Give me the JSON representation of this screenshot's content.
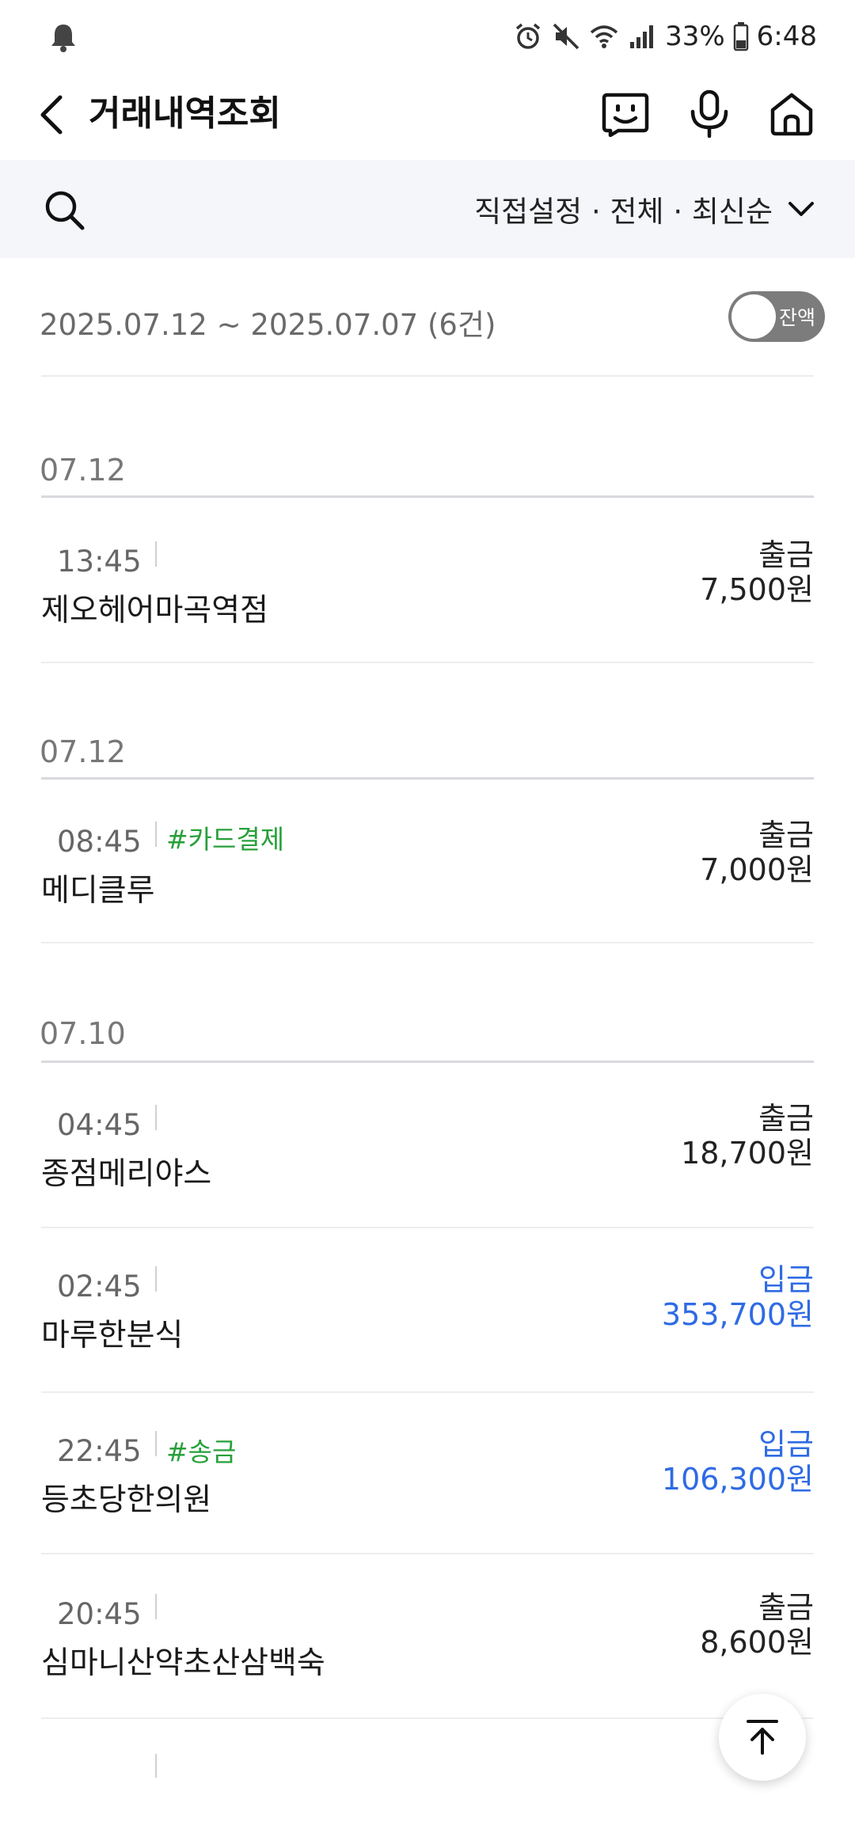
{
  "status_bar": {
    "battery": "33%",
    "time": "6:48",
    "icons": [
      "notification-bell-icon",
      "alarm-icon",
      "mute-icon",
      "wifi-icon",
      "signal-icon",
      "battery-icon"
    ]
  },
  "header": {
    "title": "거래내역조회",
    "icons": [
      "back-arrow-icon",
      "chatbot-icon",
      "microphone-icon",
      "home-icon"
    ]
  },
  "filter": {
    "label": "직접설정 · 전체 · 최신순",
    "icons": [
      "search-icon",
      "chevron-down-icon"
    ]
  },
  "summary": {
    "range": "2025.07.12 ~ 2025.07.07 (6건)",
    "balance_toggle_label": "잔액",
    "balance_toggle_on": false
  },
  "groups": [
    {
      "date": "07.12",
      "transactions": [
        {
          "time": "13:45",
          "tag": "",
          "name": "제오헤어마곡역점",
          "type": "출금",
          "amount": "7,500원",
          "direction": "out"
        }
      ]
    },
    {
      "date": "07.12",
      "transactions": [
        {
          "time": "08:45",
          "tag": "#카드결제",
          "name": "메디클루",
          "type": "출금",
          "amount": "7,000원",
          "direction": "out"
        }
      ]
    },
    {
      "date": "07.10",
      "transactions": [
        {
          "time": "04:45",
          "tag": "",
          "name": "종점메리야스",
          "type": "출금",
          "amount": "18,700원",
          "direction": "out"
        },
        {
          "time": "02:45",
          "tag": "",
          "name": "마루한분식",
          "type": "입금",
          "amount": "353,700원",
          "direction": "in"
        },
        {
          "time": "22:45",
          "tag": "#송금",
          "name": "등초당한의원",
          "type": "입금",
          "amount": "106,300원",
          "direction": "in"
        },
        {
          "time": "20:45",
          "tag": "",
          "name": "심마니산약초산삼백숙",
          "type": "출금",
          "amount": "8,600원",
          "direction": "out"
        }
      ]
    }
  ],
  "colors": {
    "deposit": "#2f6be4",
    "withdraw": "#222222",
    "tag": "#27a03a",
    "filter_bg": "#f4f6fa"
  },
  "scroll_top_icon": "arrow-up-icon"
}
